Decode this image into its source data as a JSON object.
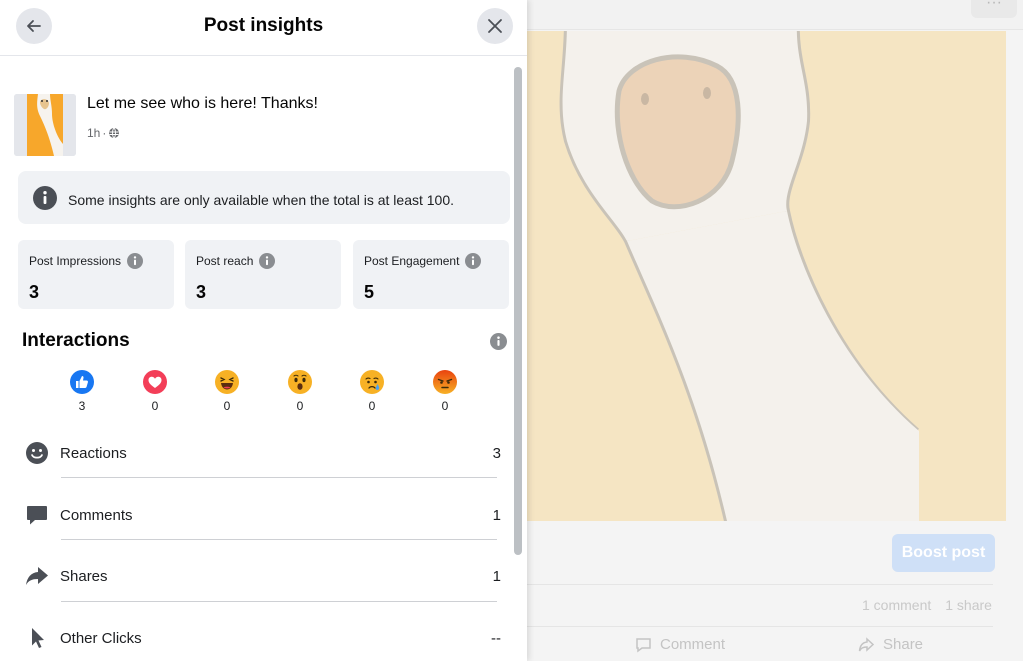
{
  "panel": {
    "title": "Post insights",
    "back_icon": "arrow-left-icon",
    "close_icon": "close-icon"
  },
  "post": {
    "text": "Let me see who is here! Thanks!",
    "time": "1h",
    "separator": "·",
    "privacy_icon": "globe-icon"
  },
  "notice": {
    "icon": "info-icon",
    "text": "Some insights are only available when the total is at least 100."
  },
  "stats": [
    {
      "label": "Post Impressions",
      "value": "3"
    },
    {
      "label": "Post reach",
      "value": "3"
    },
    {
      "label": "Post Engagement",
      "value": "5"
    }
  ],
  "interactions": {
    "title": "Interactions",
    "reactions": [
      {
        "name": "like",
        "icon": "like-reaction-icon",
        "count": "3",
        "color": "#1877f2"
      },
      {
        "name": "love",
        "icon": "love-reaction-icon",
        "count": "0",
        "color": "#f33e58"
      },
      {
        "name": "haha",
        "icon": "haha-reaction-icon",
        "count": "0",
        "color": "#f7b125"
      },
      {
        "name": "wow",
        "icon": "wow-reaction-icon",
        "count": "0",
        "color": "#f7b125"
      },
      {
        "name": "sad",
        "icon": "sad-reaction-icon",
        "count": "0",
        "color": "#f7b125"
      },
      {
        "name": "angry",
        "icon": "angry-reaction-icon",
        "count": "0",
        "color": "#e9710f"
      }
    ],
    "metrics": [
      {
        "label": "Reactions",
        "value": "3",
        "icon": "smiley-icon"
      },
      {
        "label": "Comments",
        "value": "1",
        "icon": "comment-bubble-icon"
      },
      {
        "label": "Shares",
        "value": "1",
        "icon": "share-arrow-icon"
      },
      {
        "label": "Other Clicks",
        "value": "--",
        "icon": "cursor-icon"
      }
    ]
  },
  "background": {
    "boost_label": "Boost post",
    "comment_count": "1 comment",
    "share_count": "1 share",
    "comment_action": "Comment",
    "share_action": "Share",
    "more_label": "···"
  },
  "colors": {
    "accent": "#1877f2",
    "panel_bg": "#ffffff",
    "card_bg": "#f0f2f5",
    "post_image_bg": "#f5e5c3"
  }
}
